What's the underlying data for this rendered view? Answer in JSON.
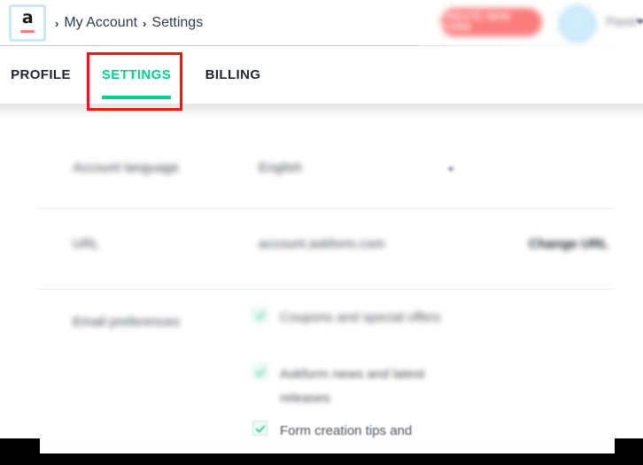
{
  "header": {
    "logo": {
      "glyph": "a",
      "name": "askform-logo"
    },
    "breadcrumb": {
      "separator": "›",
      "items": [
        {
          "label": "My Account"
        },
        {
          "label": "Settings"
        }
      ]
    },
    "cta_button": {
      "label": "CREATE NEW FORM"
    },
    "user": {
      "name": "Pavel"
    }
  },
  "tabs": [
    {
      "id": "profile",
      "label": "PROFILE",
      "active": false
    },
    {
      "id": "settings",
      "label": "SETTINGS",
      "active": true
    },
    {
      "id": "billing",
      "label": "BILLING",
      "active": false
    }
  ],
  "settings": {
    "rows": [
      {
        "label": "Account language",
        "value": "English",
        "control": "select"
      },
      {
        "label": "URL",
        "value": "account.askform.com",
        "action": "Change URL"
      },
      {
        "label": "Email preferences",
        "options": [
          {
            "label": "Coupons and special offers",
            "checked": true
          },
          {
            "label": "Askform news and latest releases",
            "checked": true
          },
          {
            "label": "Form creation tips and",
            "checked": true
          }
        ]
      }
    ]
  },
  "annotation": {
    "target": "SETTINGS",
    "color": "#fb1111"
  },
  "colors": {
    "accent_green": "#00d08a",
    "cta_red": "#fb6b6b",
    "logo_underline": "#f47c7c",
    "annotation_red": "#fb1111",
    "avatar_blue": "#cbeafb",
    "text_dark": "#2f3a4a"
  }
}
